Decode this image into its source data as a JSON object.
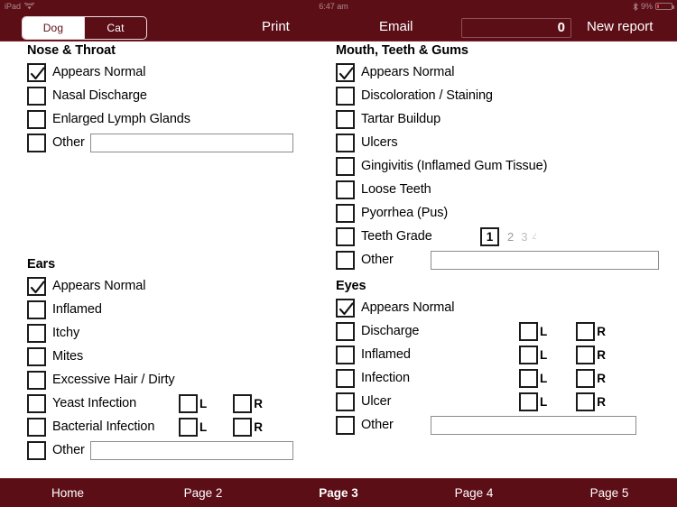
{
  "status_bar": {
    "carrier": "iPad",
    "wifi_icon": "wifi-icon",
    "time": "6:47 am",
    "bluetooth_icon": "bluetooth-icon",
    "battery_percent": "9%",
    "battery_icon": "battery-icon"
  },
  "toolbar": {
    "species_segments": [
      {
        "label": "Dog",
        "selected": true
      },
      {
        "label": "Cat",
        "selected": false
      }
    ],
    "print_label": "Print",
    "email_label": "Email",
    "counter_value": "0",
    "new_report_label": "New report"
  },
  "colors": {
    "brand_maroon": "#5C0E17",
    "toolbar_border": "#7a1f29",
    "checkbox_border": "#1a1a1a",
    "field_border": "#8c8c8c",
    "text": "#000000",
    "battery_low": "#d8464f"
  },
  "sections": {
    "nose_throat": {
      "title": "Nose & Throat",
      "rows": [
        {
          "label": "Appears Normal",
          "checked": true
        },
        {
          "label": "Nasal Discharge",
          "checked": false
        },
        {
          "label": "Enlarged Lymph Glands",
          "checked": false
        },
        {
          "label": "Other",
          "checked": false,
          "field_value": ""
        }
      ]
    },
    "ears": {
      "title": "Ears",
      "rows": [
        {
          "label": "Appears Normal",
          "checked": true
        },
        {
          "label": "Inflamed",
          "checked": false
        },
        {
          "label": "Itchy",
          "checked": false
        },
        {
          "label": "Mites",
          "checked": false
        },
        {
          "label": "Excessive Hair / Dirty",
          "checked": false
        },
        {
          "label": "Yeast Infection",
          "checked": false,
          "left_label": "L",
          "left_checked": false,
          "right_label": "R",
          "right_checked": false
        },
        {
          "label": "Bacterial Infection",
          "checked": false,
          "left_label": "L",
          "left_checked": false,
          "right_label": "R",
          "right_checked": false
        },
        {
          "label": "Other",
          "checked": false,
          "field_value": ""
        }
      ]
    },
    "mouth_teeth_gums": {
      "title": "Mouth, Teeth & Gums",
      "rows": [
        {
          "label": "Appears Normal",
          "checked": true
        },
        {
          "label": "Discoloration / Staining",
          "checked": false
        },
        {
          "label": "Tartar Buildup",
          "checked": false
        },
        {
          "label": "Ulcers",
          "checked": false
        },
        {
          "label": "Gingivitis (Inflamed Gum Tissue)",
          "checked": false
        },
        {
          "label": "Loose Teeth",
          "checked": false
        },
        {
          "label": "Pyorrhea (Pus)",
          "checked": false
        },
        {
          "label": "Teeth Grade",
          "checked": false,
          "grade_selected": "1",
          "grade_options": [
            "1",
            "2",
            "3",
            "4"
          ]
        },
        {
          "label": "Other",
          "checked": false,
          "field_value": ""
        }
      ]
    },
    "eyes": {
      "title": "Eyes",
      "rows": [
        {
          "label": "Appears Normal",
          "checked": true
        },
        {
          "label": "Discharge",
          "checked": false,
          "left_label": "L",
          "left_checked": false,
          "right_label": "R",
          "right_checked": false
        },
        {
          "label": "Inflamed",
          "checked": false,
          "left_label": "L",
          "left_checked": false,
          "right_label": "R",
          "right_checked": false
        },
        {
          "label": "Infection",
          "checked": false,
          "left_label": "L",
          "left_checked": false,
          "right_label": "R",
          "right_checked": false
        },
        {
          "label": "Ulcer",
          "checked": false,
          "left_label": "L",
          "left_checked": false,
          "right_label": "R",
          "right_checked": false
        },
        {
          "label": "Other",
          "checked": false,
          "field_value": ""
        }
      ]
    }
  },
  "tabbar": {
    "items": [
      {
        "label": "Home",
        "active": false
      },
      {
        "label": "Page 2",
        "active": false
      },
      {
        "label": "Page 3",
        "active": true
      },
      {
        "label": "Page 4",
        "active": false
      },
      {
        "label": "Page 5",
        "active": false
      }
    ]
  }
}
